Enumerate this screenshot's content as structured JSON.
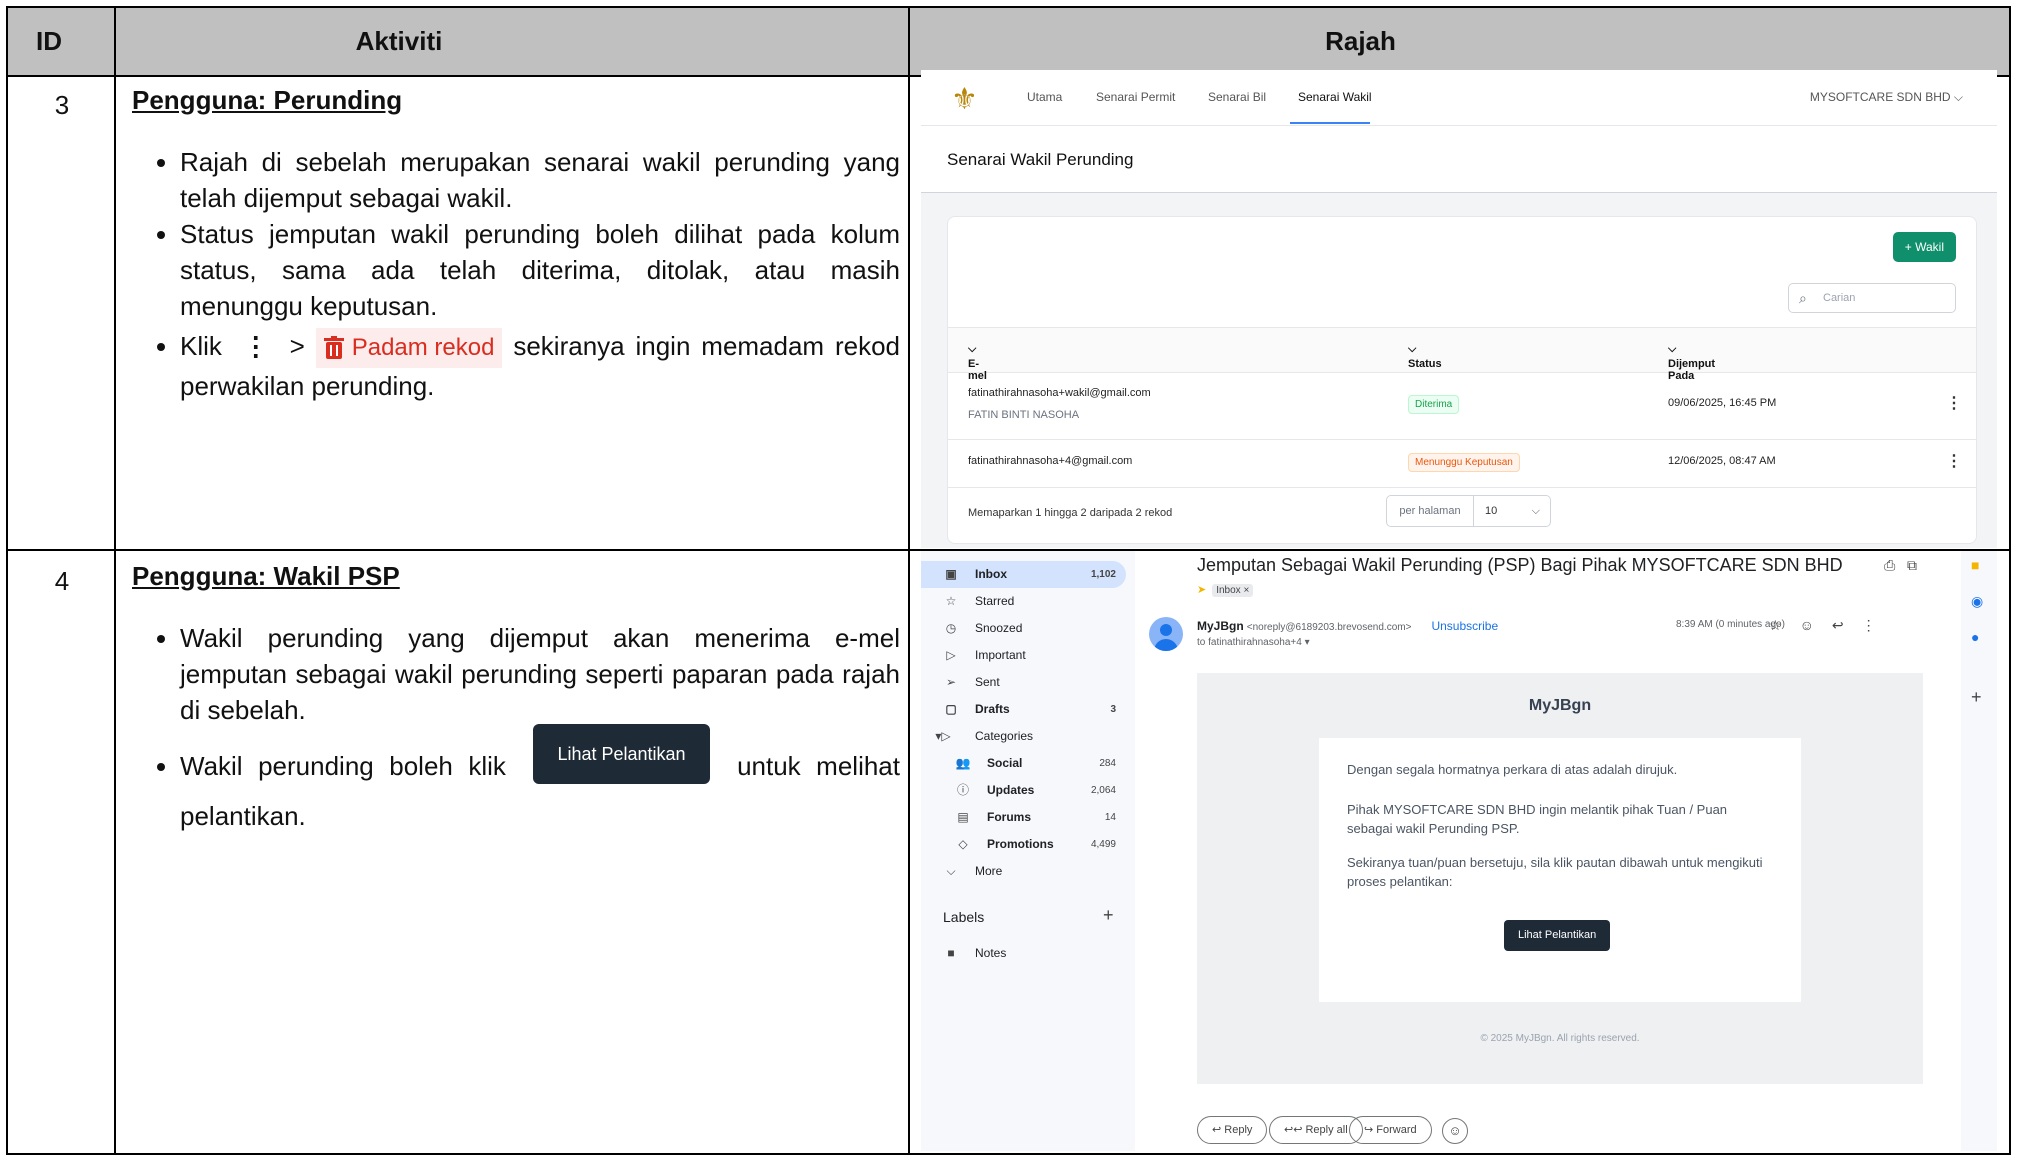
{
  "table": {
    "headers": {
      "id": "ID",
      "activity": "Aktiviti",
      "figure": "Rajah"
    },
    "row3": {
      "id": "3",
      "title": "Pengguna: Perunding",
      "bullets": [
        "Rajah di sebelah merupakan senarai wakil perunding yang telah dijemput sebagai wakil.",
        "Status jemputan wakil perunding boleh dilihat pada kolum status, sama ada telah diterima, ditolak, atau masih menunggu keputusan."
      ],
      "bullet3_prefix": "Klik",
      "bullet3_kebab": "⋮",
      "bullet3_gt": ">",
      "bullet3_delete_label": "Padam rekod",
      "bullet3_suffix": "sekiranya ingin memadam rekod perwakilan perunding."
    },
    "row4": {
      "id": "4",
      "title": "Pengguna: Wakil PSP",
      "bullet1": "Wakil perunding yang dijemput akan menerima e-mel jemputan sebagai wakil perunding seperti paparan pada rajah di sebelah.",
      "bullet2_prefix": "Wakil perunding boleh klik",
      "bullet2_button": "Lihat Pelantikan",
      "bullet2_suffix": "untuk melihat pelantikan."
    }
  },
  "shot1": {
    "nav": [
      "Utama",
      "Senarai Permit",
      "Senarai Bil",
      "Senarai Wakil"
    ],
    "org": "MYSOFTCARE SDN BHD",
    "page_title": "Senarai Wakil Perunding",
    "add_button": "+ Wakil",
    "search_placeholder": "Carian",
    "columns": {
      "email": "E-mel",
      "status": "Status",
      "invited_at": "Dijemput Pada"
    },
    "rows": [
      {
        "email": "fatinathirahnasoha+wakil@gmail.com",
        "name": "FATIN BINTI NASOHA",
        "status": "Diterima",
        "date": "09/06/2025, 16:45 PM"
      },
      {
        "email": "fatinathirahnasoha+4@gmail.com",
        "name": "",
        "status": "Menunggu Keputusan",
        "date": "12/06/2025, 08:47 AM"
      }
    ],
    "footer": "Memaparkan 1 hingga 2 daripada 2 rekod",
    "per_page_label": "per halaman",
    "per_page_value": "10"
  },
  "shot2": {
    "sidebar": [
      {
        "label": "Inbox",
        "count": "1,102",
        "icon": "▣"
      },
      {
        "label": "Starred",
        "count": "",
        "icon": "☆"
      },
      {
        "label": "Snoozed",
        "count": "",
        "icon": "◷"
      },
      {
        "label": "Important",
        "count": "",
        "icon": "▷"
      },
      {
        "label": "Sent",
        "count": "",
        "icon": "➢"
      },
      {
        "label": "Drafts",
        "count": "3",
        "icon": "▢"
      },
      {
        "label": "Categories",
        "count": "",
        "icon": "▾▷"
      }
    ],
    "categories": [
      {
        "label": "Social",
        "count": "284",
        "icon": "👥"
      },
      {
        "label": "Updates",
        "count": "2,064",
        "icon": "ⓘ"
      },
      {
        "label": "Forums",
        "count": "14",
        "icon": "▤"
      },
      {
        "label": "Promotions",
        "count": "4,499",
        "icon": "◇"
      }
    ],
    "more": "More",
    "labels_title": "Labels",
    "notes": "Notes",
    "subject": "Jemputan Sebagai Wakil Perunding (PSP) Bagi Pihak MYSOFTCARE SDN BHD",
    "tag": "Inbox ×",
    "sender_name": "MyJBgn",
    "sender_email": "<noreply@6189203.brevosend.com>",
    "unsubscribe": "Unsubscribe",
    "to": "to fatinathirahnasoha+4 ▾",
    "time": "8:39 AM (0 minutes ago)",
    "brand": "MyJBgn",
    "para1": "Dengan segala hormatnya perkara di atas adalah dirujuk.",
    "para2": "Pihak MYSOFTCARE SDN BHD ingin melantik pihak Tuan / Puan sebagai wakil Perunding PSP.",
    "para3": "Sekiranya tuan/puan bersetuju, sila klik pautan dibawah untuk mengikuti proses pelantikan:",
    "button": "Lihat Pelantikan",
    "copyright": "© 2025 MyJBgn. All rights reserved.",
    "reply": "↩ Reply",
    "reply_all": "↩↩ Reply all",
    "forward": "↪ Forward"
  }
}
